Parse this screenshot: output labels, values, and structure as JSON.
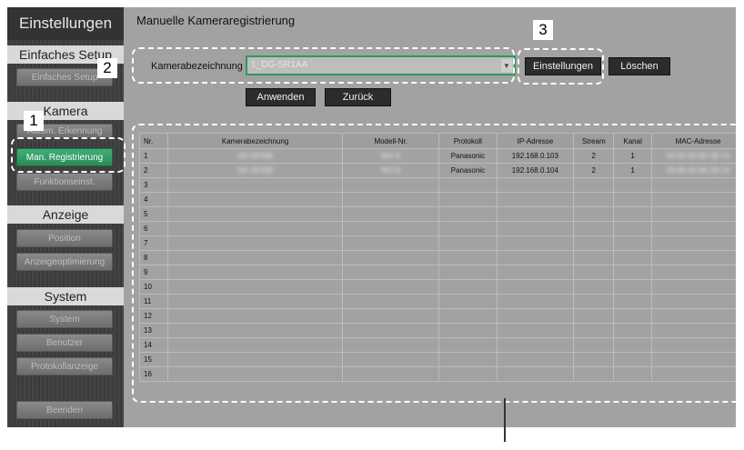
{
  "sidebar": {
    "header": "Einstellungen",
    "sections": {
      "einfaches_setup": {
        "label": "Einfaches Setup",
        "items": [
          "Einfaches Setup"
        ]
      },
      "kamera": {
        "label": "Kamera",
        "items": [
          "Autom. Erkennung",
          "Man. Registrierung",
          "Funktionseinst."
        ]
      },
      "anzeige": {
        "label": "Anzeige",
        "items": [
          "Position",
          "Anzeigeoptimierung"
        ]
      },
      "system": {
        "label": "System",
        "items": [
          "System",
          "Benutzer",
          "Protokollanzeige"
        ]
      }
    },
    "exit": "Beenden"
  },
  "main": {
    "title": "Manuelle Kameraregistrierung",
    "camera_label": "Kamerabezeichnung",
    "camera_value": "1_DG-SR1AA",
    "buttons": {
      "settings": "Einstellungen",
      "delete": "Löschen",
      "apply": "Anwenden",
      "back": "Zurück"
    }
  },
  "table": {
    "headers": [
      "Nr.",
      "Kamerabezeichnung",
      "Modell-Nr.",
      "Protokoll",
      "IP-Adresse",
      "Stream",
      "Kanal",
      "MAC-Adresse"
    ],
    "rows": [
      [
        "1",
        "DG-SF438",
        "WV-S",
        "Panasonic",
        "192.168.0.103",
        "2",
        "1",
        "00-80-45-9A-2B-13"
      ],
      [
        "2",
        "DG-SF438",
        "WV-S",
        "Panasonic",
        "192.168.0.104",
        "2",
        "1",
        "00-80-45-9A-2B-14"
      ],
      [
        "3",
        "",
        "",
        "",
        "",
        "",
        "",
        ""
      ],
      [
        "4",
        "",
        "",
        "",
        "",
        "",
        "",
        ""
      ],
      [
        "5",
        "",
        "",
        "",
        "",
        "",
        "",
        ""
      ],
      [
        "6",
        "",
        "",
        "",
        "",
        "",
        "",
        ""
      ],
      [
        "7",
        "",
        "",
        "",
        "",
        "",
        "",
        ""
      ],
      [
        "8",
        "",
        "",
        "",
        "",
        "",
        "",
        ""
      ],
      [
        "9",
        "",
        "",
        "",
        "",
        "",
        "",
        ""
      ],
      [
        "10",
        "",
        "",
        "",
        "",
        "",
        "",
        ""
      ],
      [
        "11",
        "",
        "",
        "",
        "",
        "",
        "",
        ""
      ],
      [
        "12",
        "",
        "",
        "",
        "",
        "",
        "",
        ""
      ],
      [
        "13",
        "",
        "",
        "",
        "",
        "",
        "",
        ""
      ],
      [
        "14",
        "",
        "",
        "",
        "",
        "",
        "",
        ""
      ],
      [
        "15",
        "",
        "",
        "",
        "",
        "",
        "",
        ""
      ],
      [
        "16",
        "",
        "",
        "",
        "",
        "",
        "",
        ""
      ]
    ]
  },
  "annotations": {
    "n1": "1",
    "n2": "2",
    "n3": "3"
  }
}
